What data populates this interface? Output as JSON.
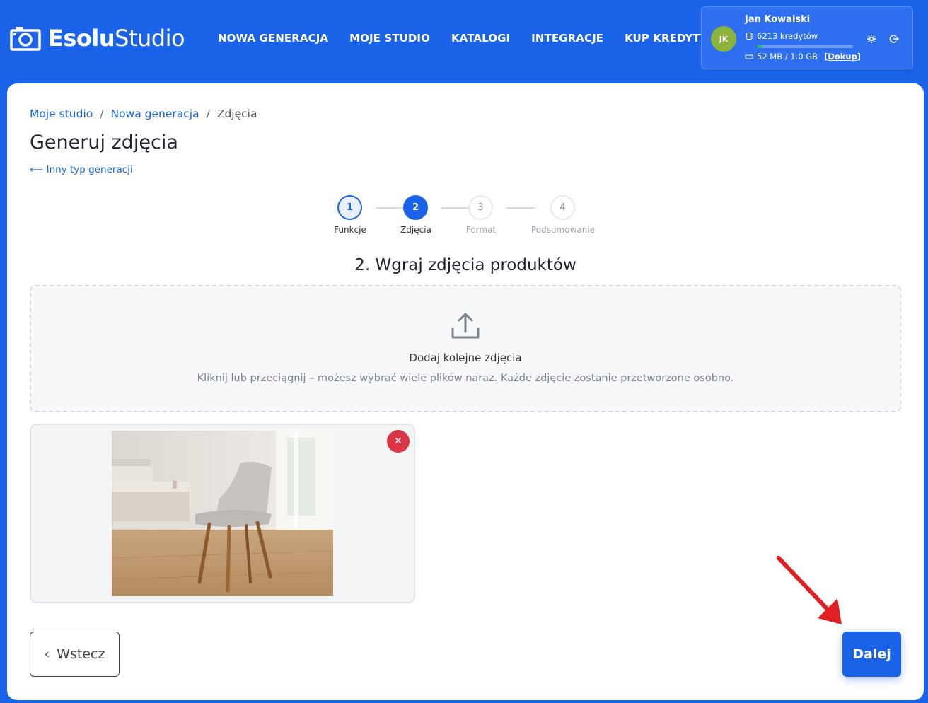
{
  "header": {
    "logo_bold": "Esolu",
    "logo_light": "Studio",
    "nav": [
      "NOWA GENERACJA",
      "MOJE STUDIO",
      "KATALOGI",
      "INTEGRACJE",
      "KUP KREDYTY"
    ]
  },
  "user": {
    "initials": "JK",
    "name": "Jan Kowalski",
    "credits": "6213 kredytów",
    "storage": "52 MB / 1.0 GB",
    "topup": "[Dokup]",
    "storage_used_fraction": 0.05
  },
  "breadcrumb": [
    "Moje studio",
    "Nowa generacja",
    "Zdjęcia"
  ],
  "page": {
    "title": "Generuj zdjęcia",
    "back_link": "⟵ Inny typ generacji",
    "section_title": "2. Wgraj zdjęcia produktów"
  },
  "stepper": [
    {
      "num": "1",
      "label": "Funkcje",
      "state": "done"
    },
    {
      "num": "2",
      "label": "Zdjęcia",
      "state": "active"
    },
    {
      "num": "3",
      "label": "Format",
      "state": "todo"
    },
    {
      "num": "4",
      "label": "Podsumowanie",
      "state": "todo"
    }
  ],
  "dropzone": {
    "title": "Dodaj kolejne zdjęcia",
    "subtitle": "Kliknij lub przeciągnij – możesz wybrać wiele plików naraz. Każde zdjęcie zostanie przetworzone osobno."
  },
  "actions": {
    "back": "Wstecz",
    "next": "Dalej"
  },
  "colors": {
    "primary": "#1a63e8",
    "danger": "#dc3545",
    "avatar": "#8bb33a",
    "arrow": "#e02020"
  }
}
